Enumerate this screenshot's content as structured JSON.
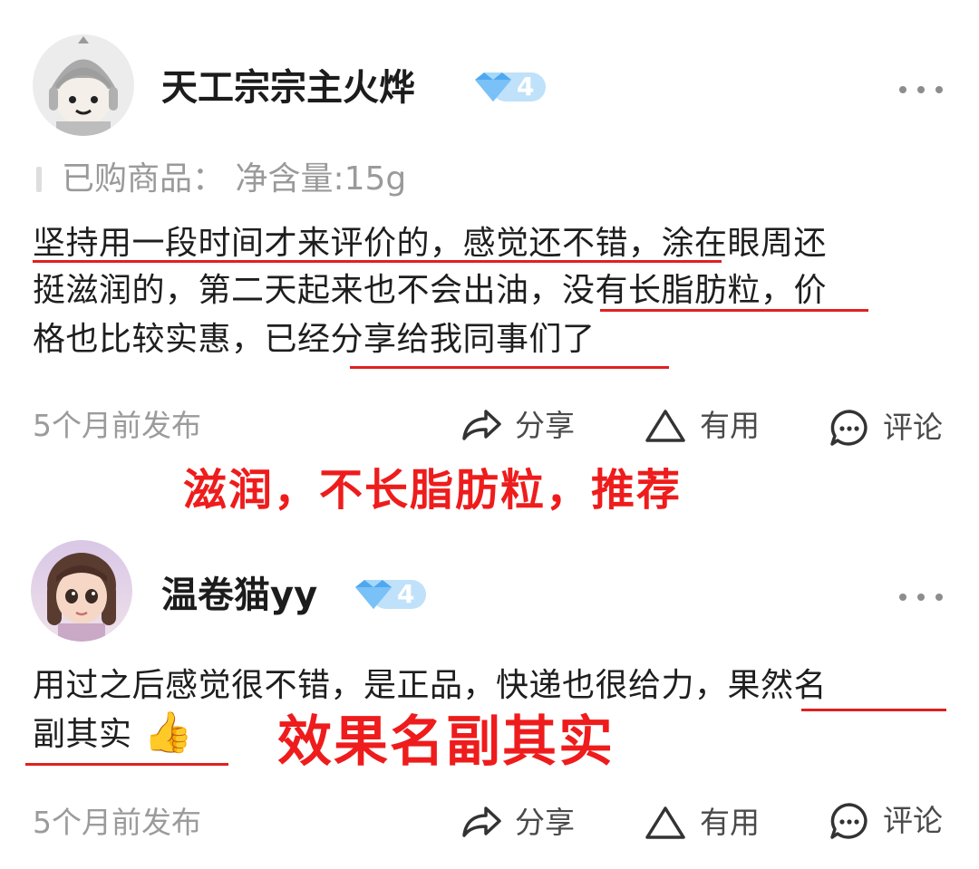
{
  "reviews": [
    {
      "username": "天工宗宗主火烨",
      "level": "4",
      "purchased": "已购商品：  净含量:15g",
      "text_lines": [
        "坚持用一段时间才来评价的，感觉还不错，涂在眼周还",
        "挺滋润的，第二天起来也不会出油，没有长脂肪粒，价",
        "格也比较实惠，已经分享给我同事们了"
      ],
      "time": "5个月前发布",
      "share_label": "分享",
      "useful_label": "有用",
      "comment_label": "评论",
      "annotation": "滋润，不长脂肪粒，推荐"
    },
    {
      "username": "温卷猫yy",
      "level": "4",
      "text_lines": [
        "用过之后感觉很不错，是正品，快递也很给力，果然名",
        "副其实"
      ],
      "emoji": "👍",
      "time": "5个月前发布",
      "share_label": "分享",
      "useful_label": "有用",
      "comment_label": "评论",
      "annotation": "效果名副其实"
    }
  ],
  "colors": {
    "annotation_red": "#ee1c1c",
    "badge_blue": "#5bb4f2",
    "muted_gray": "#9b9b9b"
  }
}
